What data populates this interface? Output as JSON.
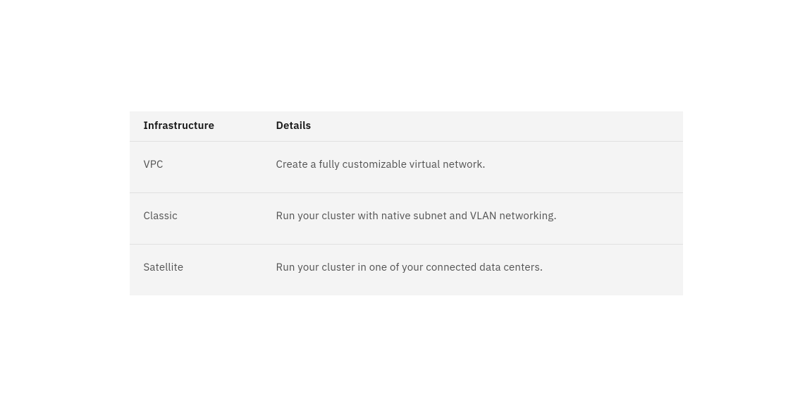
{
  "table": {
    "headers": {
      "infrastructure": "Infrastructure",
      "details": "Details"
    },
    "rows": [
      {
        "infrastructure": "VPC",
        "details": "Create a fully customizable virtual network."
      },
      {
        "infrastructure": "Classic",
        "details": "Run your cluster with native subnet and VLAN networking."
      },
      {
        "infrastructure": "Satellite",
        "details": "Run your cluster in one of your connected data centers."
      }
    ]
  }
}
